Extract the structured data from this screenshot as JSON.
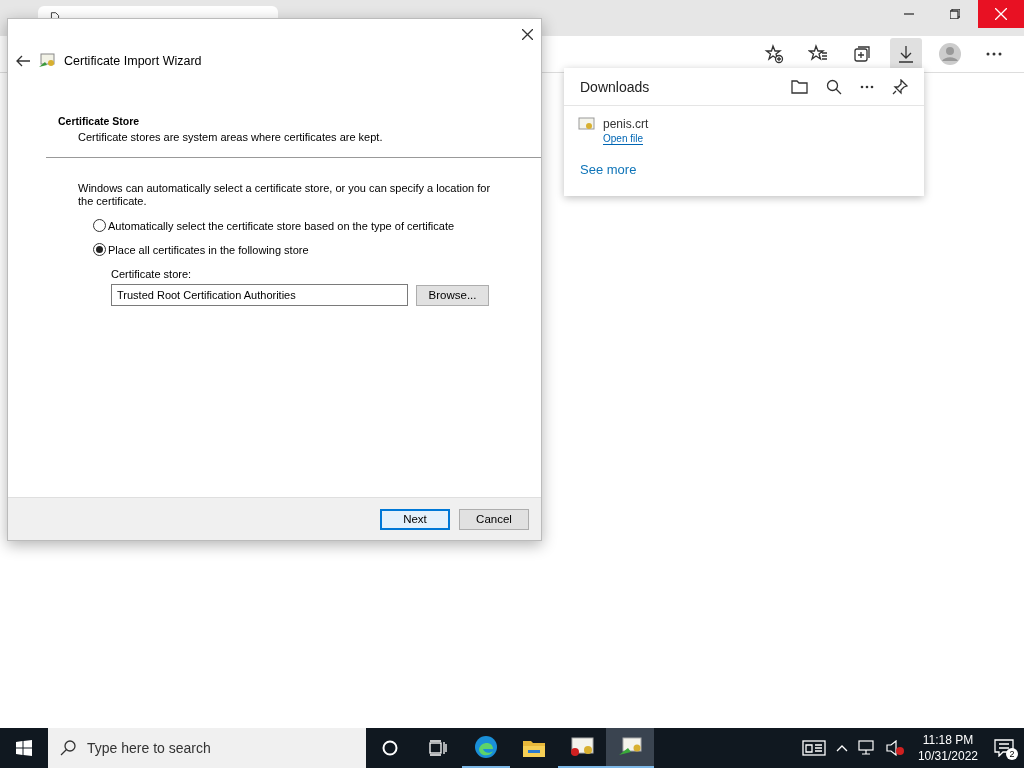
{
  "downloads": {
    "title": "Downloads",
    "items": [
      {
        "name": "penis.crt",
        "action": "Open file"
      }
    ],
    "see_more": "See more"
  },
  "dialog": {
    "title": "Certificate Import Wizard",
    "heading": "Certificate Store",
    "subheading": "Certificate stores are system areas where certificates are kept.",
    "intro": "Windows can automatically select a certificate store, or you can specify a location for the certificate.",
    "options": [
      {
        "label": "Automatically select the certificate store based on the type of certificate",
        "selected": false
      },
      {
        "label": "Place all certificates in the following store",
        "selected": true
      }
    ],
    "store_label": "Certificate store:",
    "store_value": "Trusted Root Certification Authorities",
    "browse": "Browse...",
    "buttons": [
      {
        "label": "Next",
        "default": true
      },
      {
        "label": "Cancel",
        "default": false
      }
    ]
  },
  "taskbar": {
    "search_placeholder": "Type here to search",
    "time": "11:18 PM",
    "date": "10/31/2022",
    "notifications": "2"
  }
}
